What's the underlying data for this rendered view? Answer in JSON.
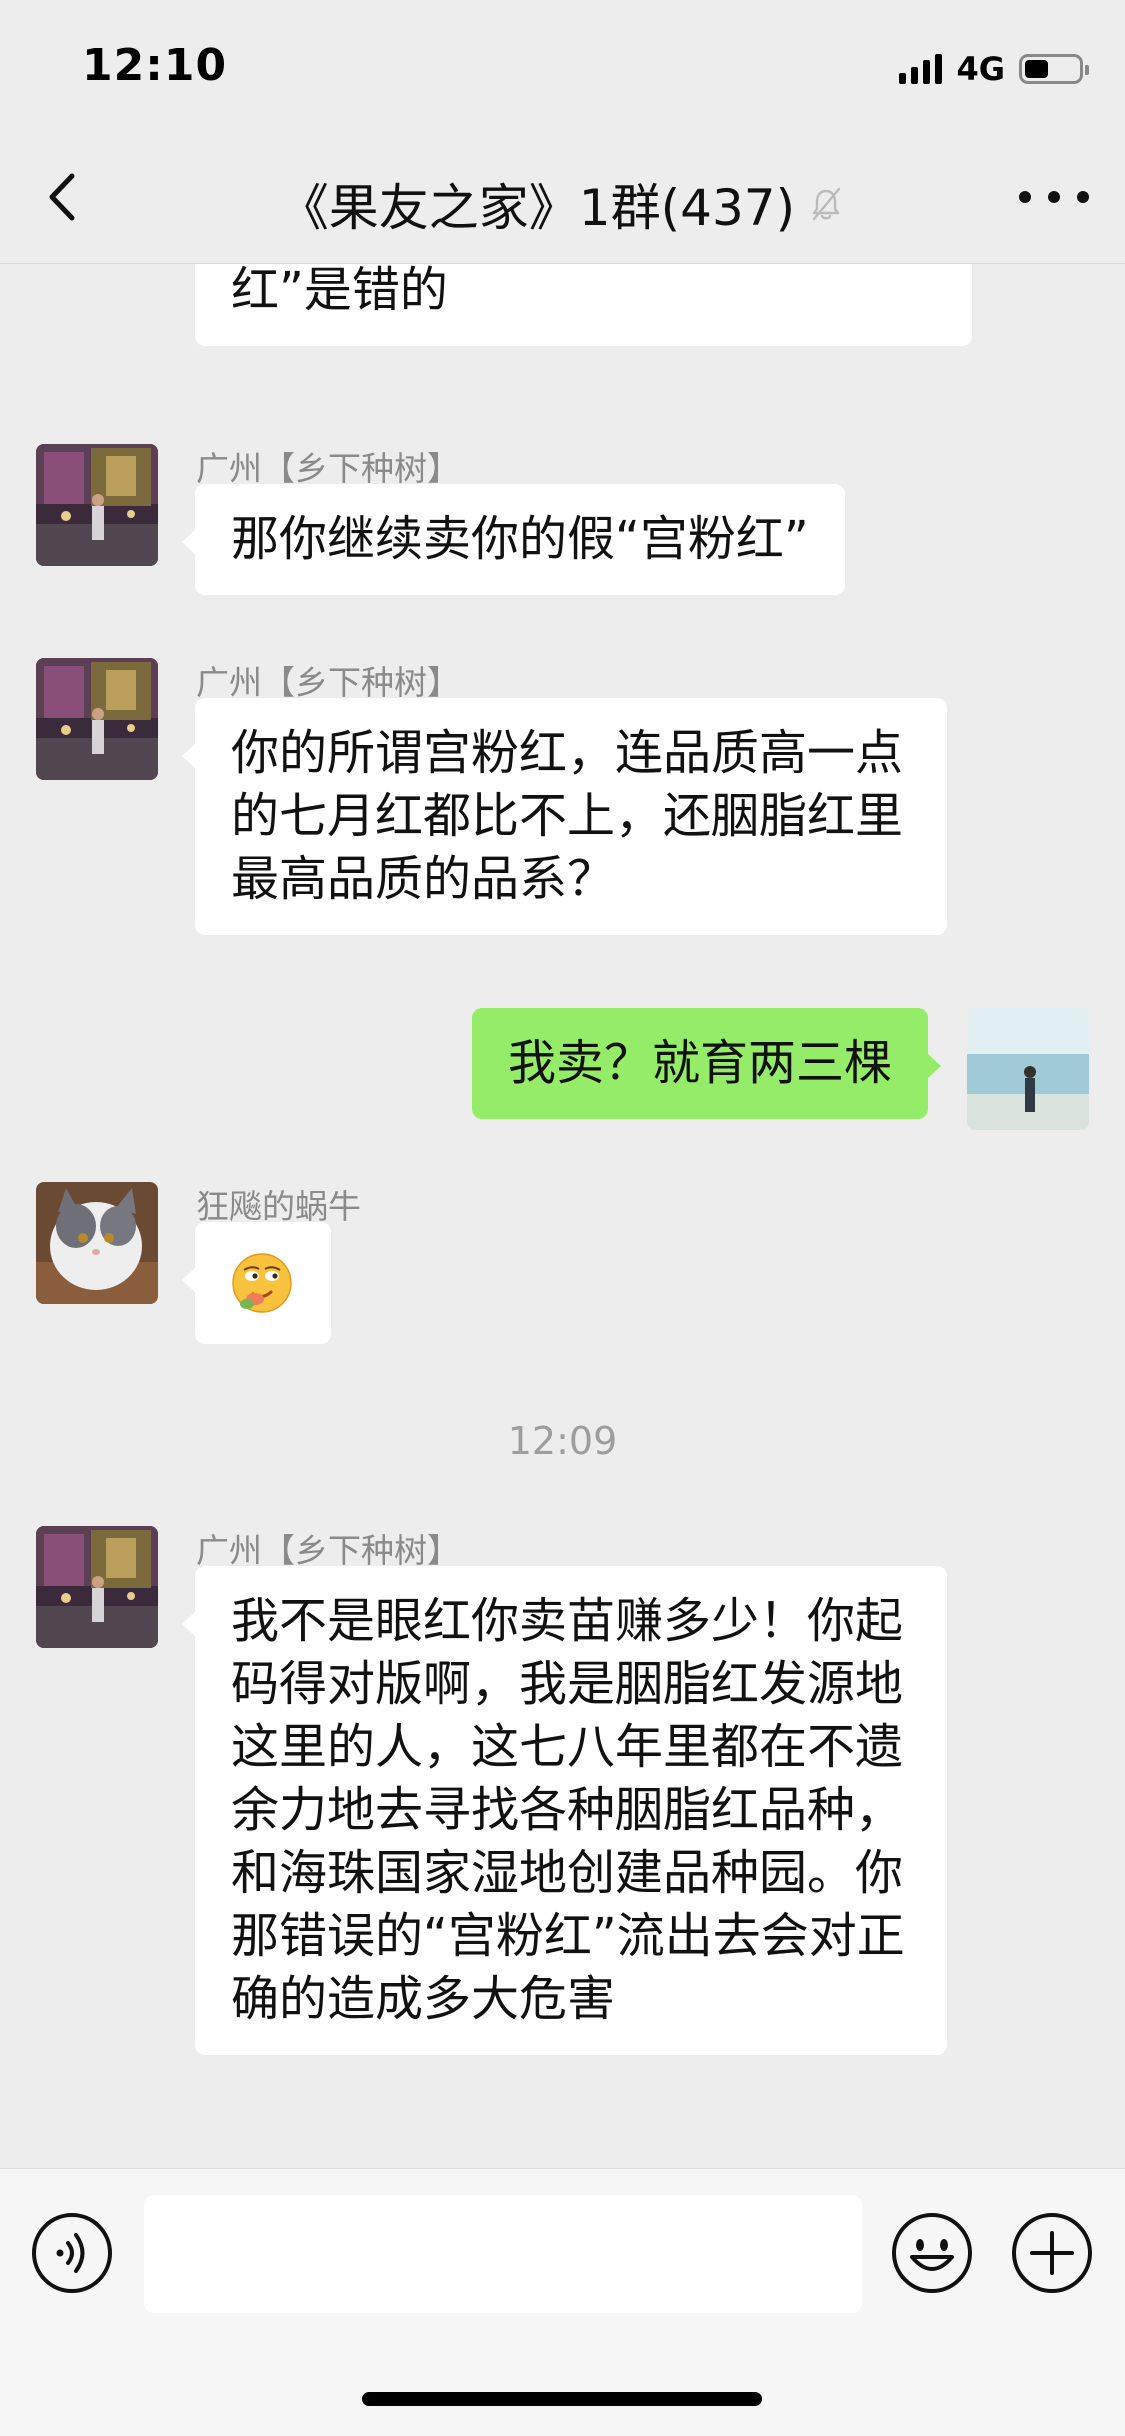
{
  "status_bar": {
    "time": "12:10",
    "network": "4G",
    "battery_level": 0.45
  },
  "nav": {
    "title": "《果友之家》1群(437)",
    "back_icon": "chevron-left-icon",
    "mute_icon": "bell-muted-icon",
    "more_icon": "more-dots-icon"
  },
  "messages": [
    {
      "type": "in",
      "sender": "",
      "text": "觉，我也说过他的另一种“宫粉红”是错的"
    },
    {
      "type": "in",
      "sender": "广州【乡下种树】",
      "text": "那你继续卖你的假“宫粉红”"
    },
    {
      "type": "in",
      "sender": "广州【乡下种树】",
      "text": "你的所谓宫粉红，连品质高一点的七月红都比不上，还胭脂红里最高品质的品系？"
    },
    {
      "type": "out",
      "text": "我卖？就育两三棵"
    },
    {
      "type": "in",
      "sender": "狂飚的蜗牛",
      "content": "emoji",
      "emoji_icon": "smirk-emoji-icon"
    },
    {
      "type": "timestamp",
      "text": "12:09"
    },
    {
      "type": "in",
      "sender": "广州【乡下种树】",
      "text": "我不是眼红你卖苗赚多少！你起码得对版啊，我是胭脂红发源地这里的人，这七八年里都在不遗余力地去寻找各种胭脂红品种，和海珠国家湿地创建品种园。你那错误的“宫粉红”流出去会对正确的造成多大危害"
    }
  ],
  "input_bar": {
    "voice_icon": "voice-icon",
    "input_value": "",
    "emoji_icon": "emoji-icon",
    "plus_icon": "plus-icon"
  }
}
